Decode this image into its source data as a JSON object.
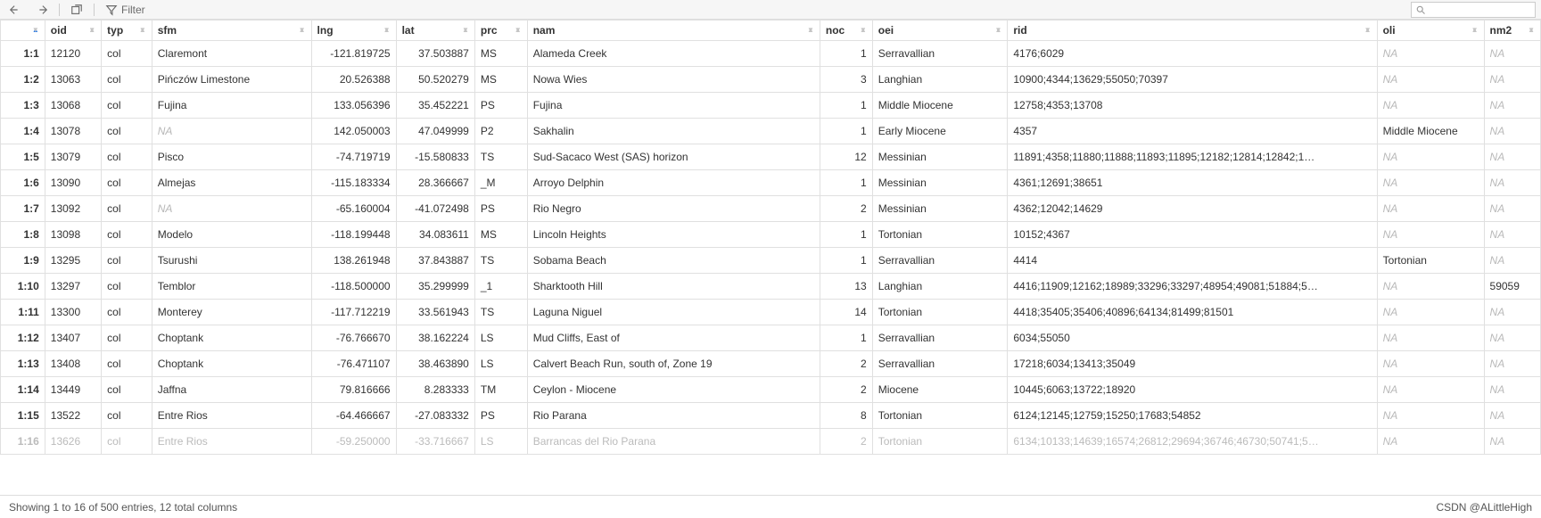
{
  "toolbar": {
    "filter_label": "Filter"
  },
  "search": {
    "placeholder": ""
  },
  "footer": {
    "status": "Showing 1 to 16 of 500 entries, 12 total columns",
    "credit": "CSDN @ALittleHigh"
  },
  "columns": [
    {
      "key": "rownum",
      "label": ""
    },
    {
      "key": "oid",
      "label": "oid"
    },
    {
      "key": "typ",
      "label": "typ"
    },
    {
      "key": "sfm",
      "label": "sfm"
    },
    {
      "key": "lng",
      "label": "lng"
    },
    {
      "key": "lat",
      "label": "lat"
    },
    {
      "key": "prc",
      "label": "prc"
    },
    {
      "key": "nam",
      "label": "nam"
    },
    {
      "key": "noc",
      "label": "noc"
    },
    {
      "key": "oei",
      "label": "oei"
    },
    {
      "key": "rid",
      "label": "rid"
    },
    {
      "key": "oli",
      "label": "oli"
    },
    {
      "key": "nm2",
      "label": "nm2"
    }
  ],
  "rows": [
    {
      "rownum": "1:1",
      "oid": "12120",
      "typ": "col",
      "sfm": "Claremont",
      "lng": "-121.819725",
      "lat": "37.503887",
      "prc": "MS",
      "nam": "Alameda Creek",
      "noc": "1",
      "oei": "Serravallian",
      "rid": "4176;6029",
      "oli": "NA",
      "nm2": "NA"
    },
    {
      "rownum": "1:2",
      "oid": "13063",
      "typ": "col",
      "sfm": "Pińczów Limestone",
      "lng": "20.526388",
      "lat": "50.520279",
      "prc": "MS",
      "nam": "Nowa Wies",
      "noc": "3",
      "oei": "Langhian",
      "rid": "10900;4344;13629;55050;70397",
      "oli": "NA",
      "nm2": "NA"
    },
    {
      "rownum": "1:3",
      "oid": "13068",
      "typ": "col",
      "sfm": "Fujina",
      "lng": "133.056396",
      "lat": "35.452221",
      "prc": "PS",
      "nam": "Fujina",
      "noc": "1",
      "oei": "Middle Miocene",
      "rid": "12758;4353;13708",
      "oli": "NA",
      "nm2": "NA"
    },
    {
      "rownum": "1:4",
      "oid": "13078",
      "typ": "col",
      "sfm": "NA",
      "lng": "142.050003",
      "lat": "47.049999",
      "prc": "P2",
      "nam": "Sakhalin",
      "noc": "1",
      "oei": "Early Miocene",
      "rid": "4357",
      "oli": "Middle Miocene",
      "nm2": "NA"
    },
    {
      "rownum": "1:5",
      "oid": "13079",
      "typ": "col",
      "sfm": "Pisco",
      "lng": "-74.719719",
      "lat": "-15.580833",
      "prc": "TS",
      "nam": "Sud-Sacaco West (SAS) horizon",
      "noc": "12",
      "oei": "Messinian",
      "rid": "11891;4358;11880;11888;11893;11895;12182;12814;12842;1…",
      "oli": "NA",
      "nm2": "NA"
    },
    {
      "rownum": "1:6",
      "oid": "13090",
      "typ": "col",
      "sfm": "Almejas",
      "lng": "-115.183334",
      "lat": "28.366667",
      "prc": "_M",
      "nam": "Arroyo Delphin",
      "noc": "1",
      "oei": "Messinian",
      "rid": "4361;12691;38651",
      "oli": "NA",
      "nm2": "NA"
    },
    {
      "rownum": "1:7",
      "oid": "13092",
      "typ": "col",
      "sfm": "NA",
      "lng": "-65.160004",
      "lat": "-41.072498",
      "prc": "PS",
      "nam": "Rio Negro",
      "noc": "2",
      "oei": "Messinian",
      "rid": "4362;12042;14629",
      "oli": "NA",
      "nm2": "NA"
    },
    {
      "rownum": "1:8",
      "oid": "13098",
      "typ": "col",
      "sfm": "Modelo",
      "lng": "-118.199448",
      "lat": "34.083611",
      "prc": "MS",
      "nam": "Lincoln Heights",
      "noc": "1",
      "oei": "Tortonian",
      "rid": "10152;4367",
      "oli": "NA",
      "nm2": "NA"
    },
    {
      "rownum": "1:9",
      "oid": "13295",
      "typ": "col",
      "sfm": "Tsurushi",
      "lng": "138.261948",
      "lat": "37.843887",
      "prc": "TS",
      "nam": "Sobama Beach",
      "noc": "1",
      "oei": "Serravallian",
      "rid": "4414",
      "oli": "Tortonian",
      "nm2": "NA"
    },
    {
      "rownum": "1:10",
      "oid": "13297",
      "typ": "col",
      "sfm": "Temblor",
      "lng": "-118.500000",
      "lat": "35.299999",
      "prc": "_1",
      "nam": "Sharktooth Hill",
      "noc": "13",
      "oei": "Langhian",
      "rid": "4416;11909;12162;18989;33296;33297;48954;49081;51884;5…",
      "oli": "NA",
      "nm2": "59059"
    },
    {
      "rownum": "1:11",
      "oid": "13300",
      "typ": "col",
      "sfm": "Monterey",
      "lng": "-117.712219",
      "lat": "33.561943",
      "prc": "TS",
      "nam": "Laguna Niguel",
      "noc": "14",
      "oei": "Tortonian",
      "rid": "4418;35405;35406;40896;64134;81499;81501",
      "oli": "NA",
      "nm2": "NA"
    },
    {
      "rownum": "1:12",
      "oid": "13407",
      "typ": "col",
      "sfm": "Choptank",
      "lng": "-76.766670",
      "lat": "38.162224",
      "prc": "LS",
      "nam": "Mud Cliffs, East of",
      "noc": "1",
      "oei": "Serravallian",
      "rid": "6034;55050",
      "oli": "NA",
      "nm2": "NA"
    },
    {
      "rownum": "1:13",
      "oid": "13408",
      "typ": "col",
      "sfm": "Choptank",
      "lng": "-76.471107",
      "lat": "38.463890",
      "prc": "LS",
      "nam": "Calvert Beach Run, south of, Zone 19",
      "noc": "2",
      "oei": "Serravallian",
      "rid": "17218;6034;13413;35049",
      "oli": "NA",
      "nm2": "NA"
    },
    {
      "rownum": "1:14",
      "oid": "13449",
      "typ": "col",
      "sfm": "Jaffna",
      "lng": "79.816666",
      "lat": "8.283333",
      "prc": "TM",
      "nam": "Ceylon - Miocene",
      "noc": "2",
      "oei": "Miocene",
      "rid": "10445;6063;13722;18920",
      "oli": "NA",
      "nm2": "NA"
    },
    {
      "rownum": "1:15",
      "oid": "13522",
      "typ": "col",
      "sfm": "Entre Rios",
      "lng": "-64.466667",
      "lat": "-27.083332",
      "prc": "PS",
      "nam": "Rio Parana",
      "noc": "8",
      "oei": "Tortonian",
      "rid": "6124;12145;12759;15250;17683;54852",
      "oli": "NA",
      "nm2": "NA"
    },
    {
      "rownum": "1:16",
      "oid": "13626",
      "typ": "col",
      "sfm": "Entre Rios",
      "lng": "-59.250000",
      "lat": "-33.716667",
      "prc": "LS",
      "nam": "Barrancas del Rio Parana",
      "noc": "2",
      "oei": "Tortonian",
      "rid": "6134;10133;14639;16574;26812;29694;36746;46730;50741;5…",
      "oli": "NA",
      "nm2": "NA"
    }
  ]
}
